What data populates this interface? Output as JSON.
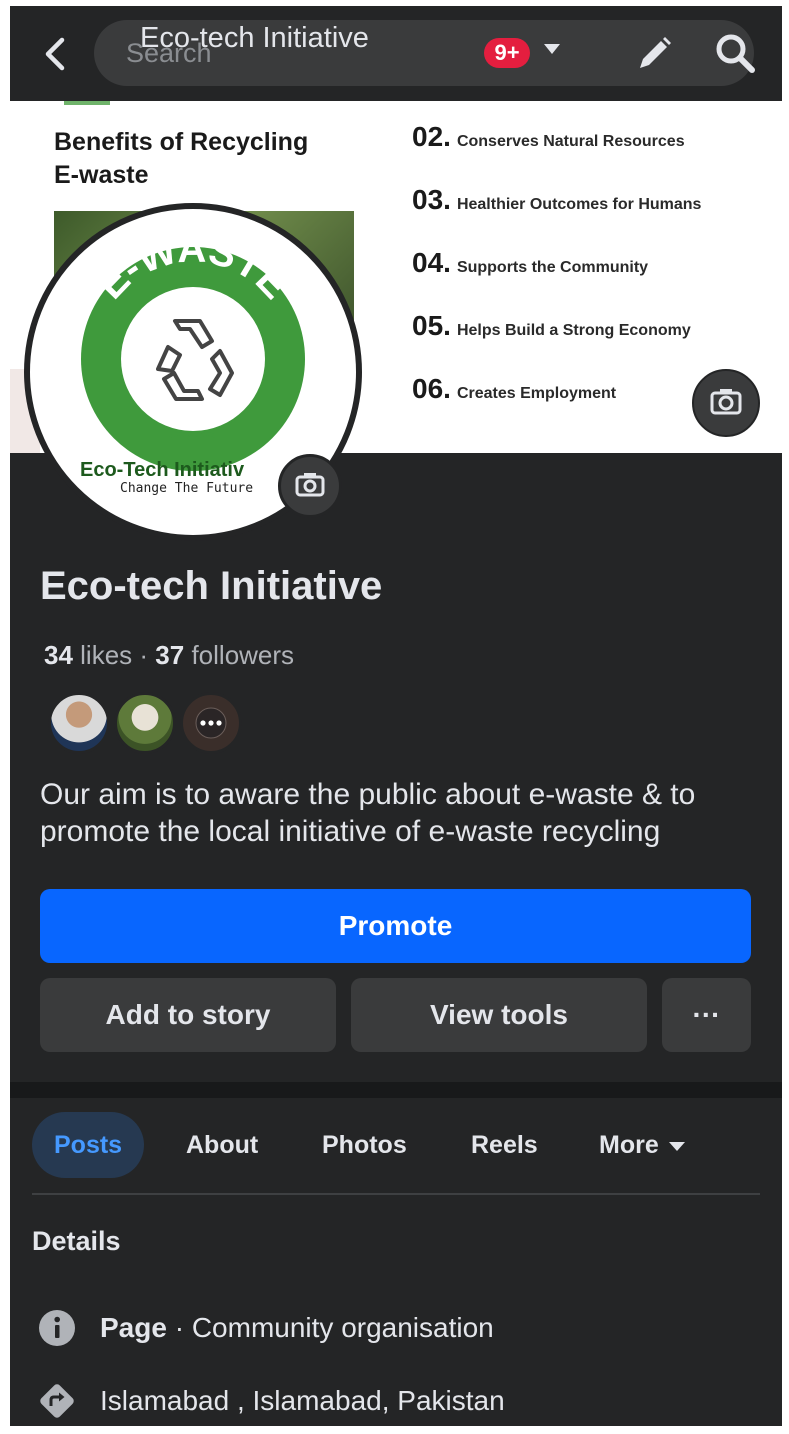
{
  "topbar": {
    "search_placeholder": "Search",
    "page_title": "Eco-tech Initiative",
    "notification_badge": "9+"
  },
  "cover": {
    "title": "Benefits of Recycling E-waste",
    "benefits": [
      {
        "num": "02.",
        "text": "Conserves Natural Resources"
      },
      {
        "num": "03.",
        "text": "Healthier Outcomes for Humans"
      },
      {
        "num": "04.",
        "text": "Supports the Community"
      },
      {
        "num": "05.",
        "text": "Helps Build a Strong Economy"
      },
      {
        "num": "06.",
        "text": "Creates Employment"
      }
    ]
  },
  "profile": {
    "logo_word": "E-WASTE",
    "logo_org": "Eco-Tech Initiativ",
    "logo_tagline": "Change The Future",
    "name": "Eco-tech Initiative",
    "likes_count": "34",
    "likes_label": "likes",
    "followers_count": "37",
    "followers_label": "followers",
    "bio": "Our aim is to aware the public about e-waste & to promote the local initiative of e-waste recycling"
  },
  "actions": {
    "promote": "Promote",
    "add_story": "Add to story",
    "view_tools": "View tools",
    "more": "···"
  },
  "tabs": {
    "posts": "Posts",
    "about": "About",
    "photos": "Photos",
    "reels": "Reels",
    "more": "More"
  },
  "details": {
    "heading": "Details",
    "page_type_label": "Page",
    "page_type_value": "Community organisation",
    "location": "Islamabad , Islamabad, Pakistan"
  },
  "colors": {
    "background": "#242526",
    "primary_button": "#0866ff",
    "secondary_button": "#3a3b3c",
    "active_tab_bg": "#263951",
    "active_tab_text": "#4599ff",
    "badge": "#e41e3f",
    "logo_green": "#3f9a3c"
  }
}
